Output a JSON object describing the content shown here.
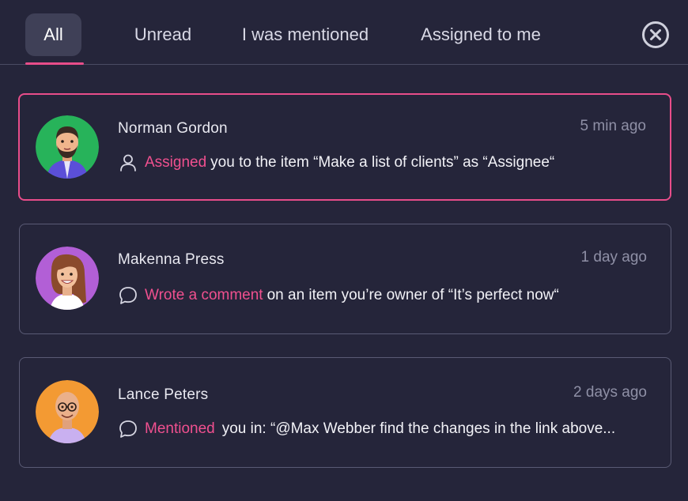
{
  "tabs": [
    {
      "label": "All",
      "active": true
    },
    {
      "label": "Unread",
      "active": false
    },
    {
      "label": "I was mentioned",
      "active": false
    },
    {
      "label": "Assigned to me",
      "active": false
    }
  ],
  "close_icon": "close-circle-icon",
  "colors": {
    "background": "#25253a",
    "accent": "#e84d8a",
    "card_border": "#5a5b75",
    "muted_text": "#8f90a6"
  },
  "notifications": [
    {
      "name": "Norman Gordon",
      "time": "5 min ago",
      "icon": "user-icon",
      "action": "Assigned",
      "text": "you to the item “Make a list of clients” as “Assignee“",
      "avatar_bg": "#27b35a",
      "active": true
    },
    {
      "name": "Makenna Press",
      "time": "1 day ago",
      "icon": "comment-icon",
      "action": "Wrote a comment",
      "text": "on an item you’re owner of “It’s perfect now“",
      "avatar_bg": "#b25fd6",
      "active": false
    },
    {
      "name": "Lance Peters",
      "time": "2 days ago",
      "icon": "comment-icon",
      "action": "Mentioned",
      "text": "you in: “@Max Webber find the changes in the link above...",
      "avatar_bg": "#f39a33",
      "active": false
    }
  ]
}
